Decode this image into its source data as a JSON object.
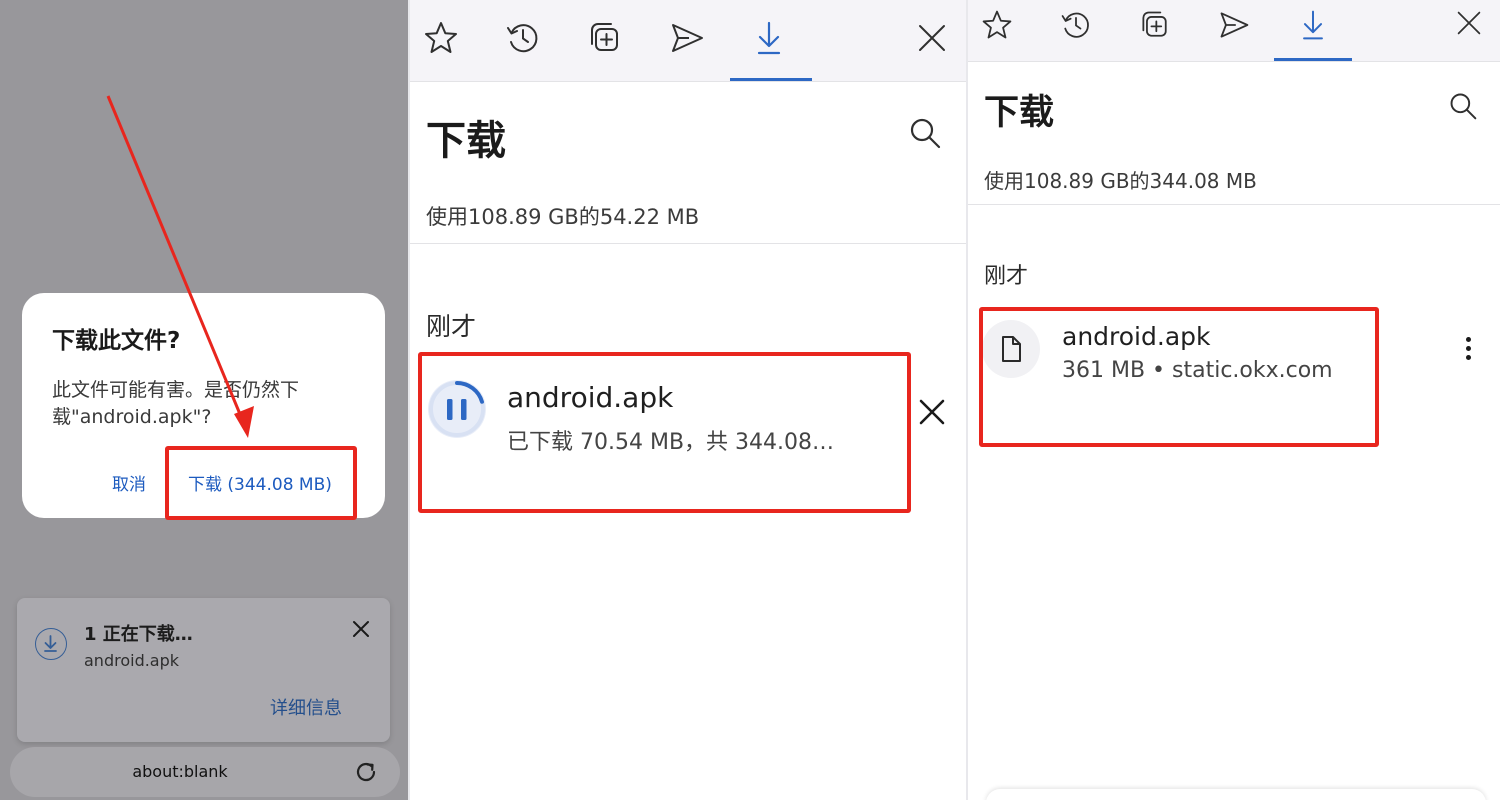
{
  "left_panel": {
    "dialog": {
      "title": "下载此文件?",
      "message": "此文件可能有害。是否仍然下载\"android.apk\"?",
      "cancel_label": "取消",
      "confirm_label": "下载 (344.08 MB)"
    },
    "snackbar": {
      "title": "1 正在下载…",
      "filename": "android.apk",
      "details_label": "详细信息"
    },
    "address_bar": {
      "url": "about:blank"
    }
  },
  "middle_panel": {
    "tabs": [
      "star-icon",
      "history-icon",
      "tabs-icon",
      "send-icon",
      "download-icon"
    ],
    "active_tab": 4,
    "heading": "下载",
    "storage": "使用108.89 GB的54.22 MB",
    "section": "刚才",
    "item": {
      "name": "android.apk",
      "status": "已下载 70.54 MB，共 344.08…",
      "progress_fraction": 0.205
    }
  },
  "right_panel": {
    "tabs": [
      "star-icon",
      "history-icon",
      "tabs-icon",
      "send-icon",
      "download-icon"
    ],
    "active_tab": 4,
    "heading": "下载",
    "storage": "使用108.89 GB的344.08 MB",
    "section": "刚才",
    "item": {
      "name": "android.apk",
      "info": "361 MB • static.okx.com"
    }
  },
  "colors": {
    "accent": "#2d68c4",
    "highlight": "#e8261e",
    "overlay": "#98979b"
  }
}
